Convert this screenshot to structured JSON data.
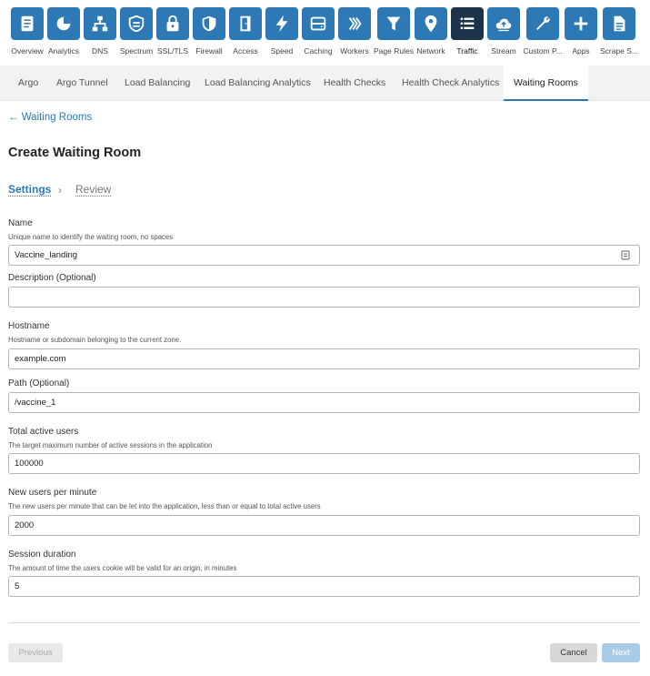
{
  "toolbar": {
    "items": [
      {
        "label": "Overview",
        "icon": "document-icon"
      },
      {
        "label": "Analytics",
        "icon": "pie-chart-icon"
      },
      {
        "label": "DNS",
        "icon": "network-tree-icon"
      },
      {
        "label": "Spectrum",
        "icon": "shield-server-icon"
      },
      {
        "label": "SSL/TLS",
        "icon": "lock-icon"
      },
      {
        "label": "Firewall",
        "icon": "shield-icon"
      },
      {
        "label": "Access",
        "icon": "door-icon"
      },
      {
        "label": "Speed",
        "icon": "lightning-icon"
      },
      {
        "label": "Caching",
        "icon": "drive-icon"
      },
      {
        "label": "Workers",
        "icon": "workers-icon"
      },
      {
        "label": "Page Rules",
        "icon": "filter-icon"
      },
      {
        "label": "Network",
        "icon": "location-pin-icon"
      },
      {
        "label": "Traffic",
        "icon": "list-icon"
      },
      {
        "label": "Stream",
        "icon": "cloud-upload-icon"
      },
      {
        "label": "Custom P...",
        "icon": "wrench-icon"
      },
      {
        "label": "Apps",
        "icon": "plus-icon"
      },
      {
        "label": "Scrape S...",
        "icon": "page-icon"
      }
    ],
    "active": "Traffic",
    "accent": "#2d79b5",
    "active_color": "#1d3349"
  },
  "subnav": {
    "tabs": [
      "Argo",
      "Argo Tunnel",
      "Load Balancing",
      "Load Balancing Analytics",
      "Health Checks",
      "Health Check Analytics",
      "Waiting Rooms"
    ],
    "active": "Waiting Rooms"
  },
  "back_link": "← Waiting Rooms",
  "page_title": "Create Waiting Room",
  "steps": {
    "step1": "Settings",
    "step2": "Review",
    "separator": "›"
  },
  "form": {
    "name": {
      "label": "Name",
      "help": "Unique name to identify the waiting room, no spaces",
      "value": "Vaccine_landing"
    },
    "description": {
      "label": "Description (Optional)",
      "value": ""
    },
    "hostname": {
      "label": "Hostname",
      "help": "Hostname or subdomain belonging to the current zone.",
      "value": "example.com"
    },
    "path": {
      "label": "Path (Optional)",
      "value": "/vaccine_1"
    },
    "total_users": {
      "label": "Total active users",
      "help": "The target maximum number of active sessions in the application",
      "value": "100000"
    },
    "new_users": {
      "label": "New users per minute",
      "help": "The new users per minute that can be let into the application, less than or equal to total active users",
      "value": "2000"
    },
    "session": {
      "label": "Session duration",
      "help": "The amount of time the users cookie will be valid for an origin, in minutes",
      "value": "5"
    }
  },
  "buttons": {
    "previous": "Previous",
    "cancel": "Cancel",
    "next": "Next"
  }
}
